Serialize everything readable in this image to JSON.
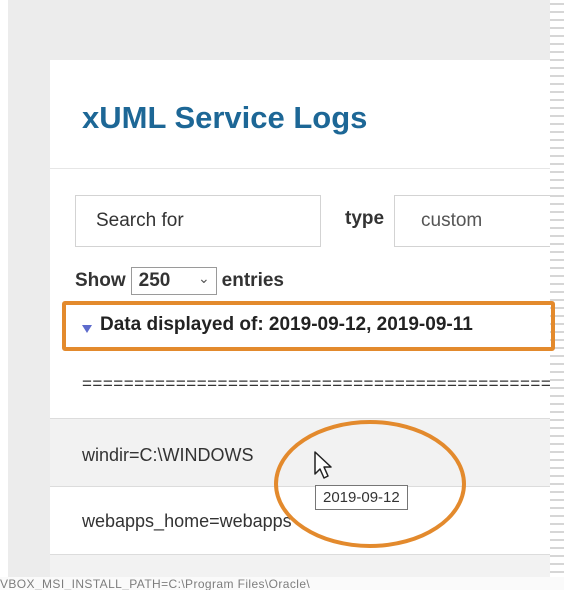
{
  "page": {
    "title": "xUML Service Logs"
  },
  "filters": {
    "search_value": "Search for",
    "type_label": "type",
    "type_value": "custom",
    "show_label": "Show",
    "entries_value": "250",
    "entries_label": "entries"
  },
  "date_header": "Data displayed of: 2019-09-12, 2019-09-11",
  "log": {
    "separator": "==================================================",
    "rows": [
      "windir=C:\\WINDOWS",
      "webapps_home=webapps",
      ""
    ]
  },
  "tooltip": "2019-09-12",
  "bottom_text": "VBOX_MSI_INSTALL_PATH=C:\\Program Files\\Oracle\\"
}
